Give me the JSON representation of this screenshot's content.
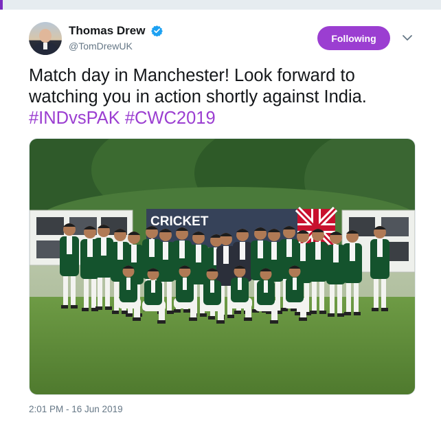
{
  "tweet": {
    "author": {
      "name": "Thomas Drew",
      "handle": "@TomDrewUK",
      "verified": true,
      "avatar_icon": "profile-photo"
    },
    "follow_button_label": "Following",
    "menu_icon": "chevron-down-icon",
    "text_main": "Match day in Manchester!  Look forward to watching you in action shortly against India.",
    "hashtags": [
      "#INDvsPAK",
      "#CWC2019"
    ],
    "photo": {
      "banner_text": "CRICKET"
    },
    "timestamp": "2:01 PM - 16 Jun 2019"
  },
  "colors": {
    "accent": "#9b3ed1",
    "verified_blue": "#1da1f2",
    "blazer_green": "#14532d",
    "grass": "#5f8f3a"
  }
}
